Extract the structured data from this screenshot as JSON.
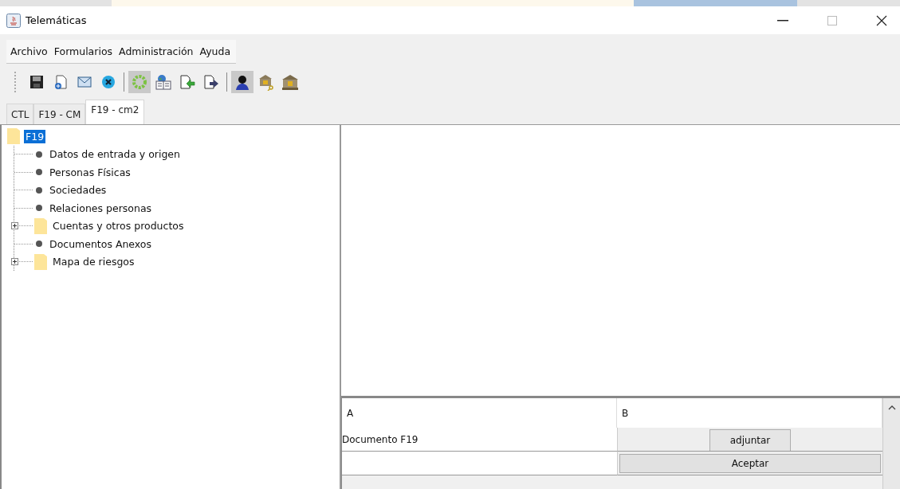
{
  "window": {
    "title": "Telemáticas"
  },
  "menu": [
    "Archivo",
    "Formularios",
    "Administración",
    "Ayuda"
  ],
  "toolbar": [
    {
      "kind": "save",
      "pressed": false
    },
    {
      "kind": "new-document",
      "pressed": false
    },
    {
      "kind": "mail",
      "pressed": false
    },
    {
      "kind": "x-circle",
      "pressed": false
    },
    {
      "kind": "separator"
    },
    {
      "kind": "gear",
      "pressed": true
    },
    {
      "kind": "globe-book",
      "pressed": false
    },
    {
      "kind": "doc-in",
      "pressed": false
    },
    {
      "kind": "doc-out",
      "pressed": false
    },
    {
      "kind": "separator"
    },
    {
      "kind": "person",
      "pressed": true
    },
    {
      "kind": "bank-key",
      "pressed": false
    },
    {
      "kind": "bank",
      "pressed": false
    }
  ],
  "tabs": [
    {
      "label": "CTL",
      "selected": false
    },
    {
      "label": "F19 - CM",
      "selected": false
    },
    {
      "label": "F19 - cm2",
      "selected": true
    }
  ],
  "tree": {
    "label": "F19",
    "kind": "folder",
    "selected": true,
    "children": [
      {
        "label": "Datos de entrada y origen",
        "kind": "leaf",
        "selected": false
      },
      {
        "label": "Personas Físicas",
        "kind": "leaf",
        "selected": false
      },
      {
        "label": "Sociedades",
        "kind": "leaf",
        "selected": false
      },
      {
        "label": "Relaciones personas",
        "kind": "leaf",
        "selected": false
      },
      {
        "label": "Cuentas y otros productos",
        "kind": "folder",
        "expanded": false,
        "selected": false
      },
      {
        "label": "Documentos Anexos",
        "kind": "leaf",
        "selected": false
      },
      {
        "label": "Mapa de riesgos",
        "kind": "folder",
        "expanded": false,
        "selected": false
      }
    ]
  },
  "table": {
    "columns": [
      "A",
      "B"
    ],
    "rows": [
      {
        "a": "Documento F19",
        "b": {
          "kind": "button",
          "label": "adjuntar"
        }
      },
      {
        "b": {
          "kind": "wide-button",
          "label": "Aceptar"
        }
      }
    ]
  }
}
